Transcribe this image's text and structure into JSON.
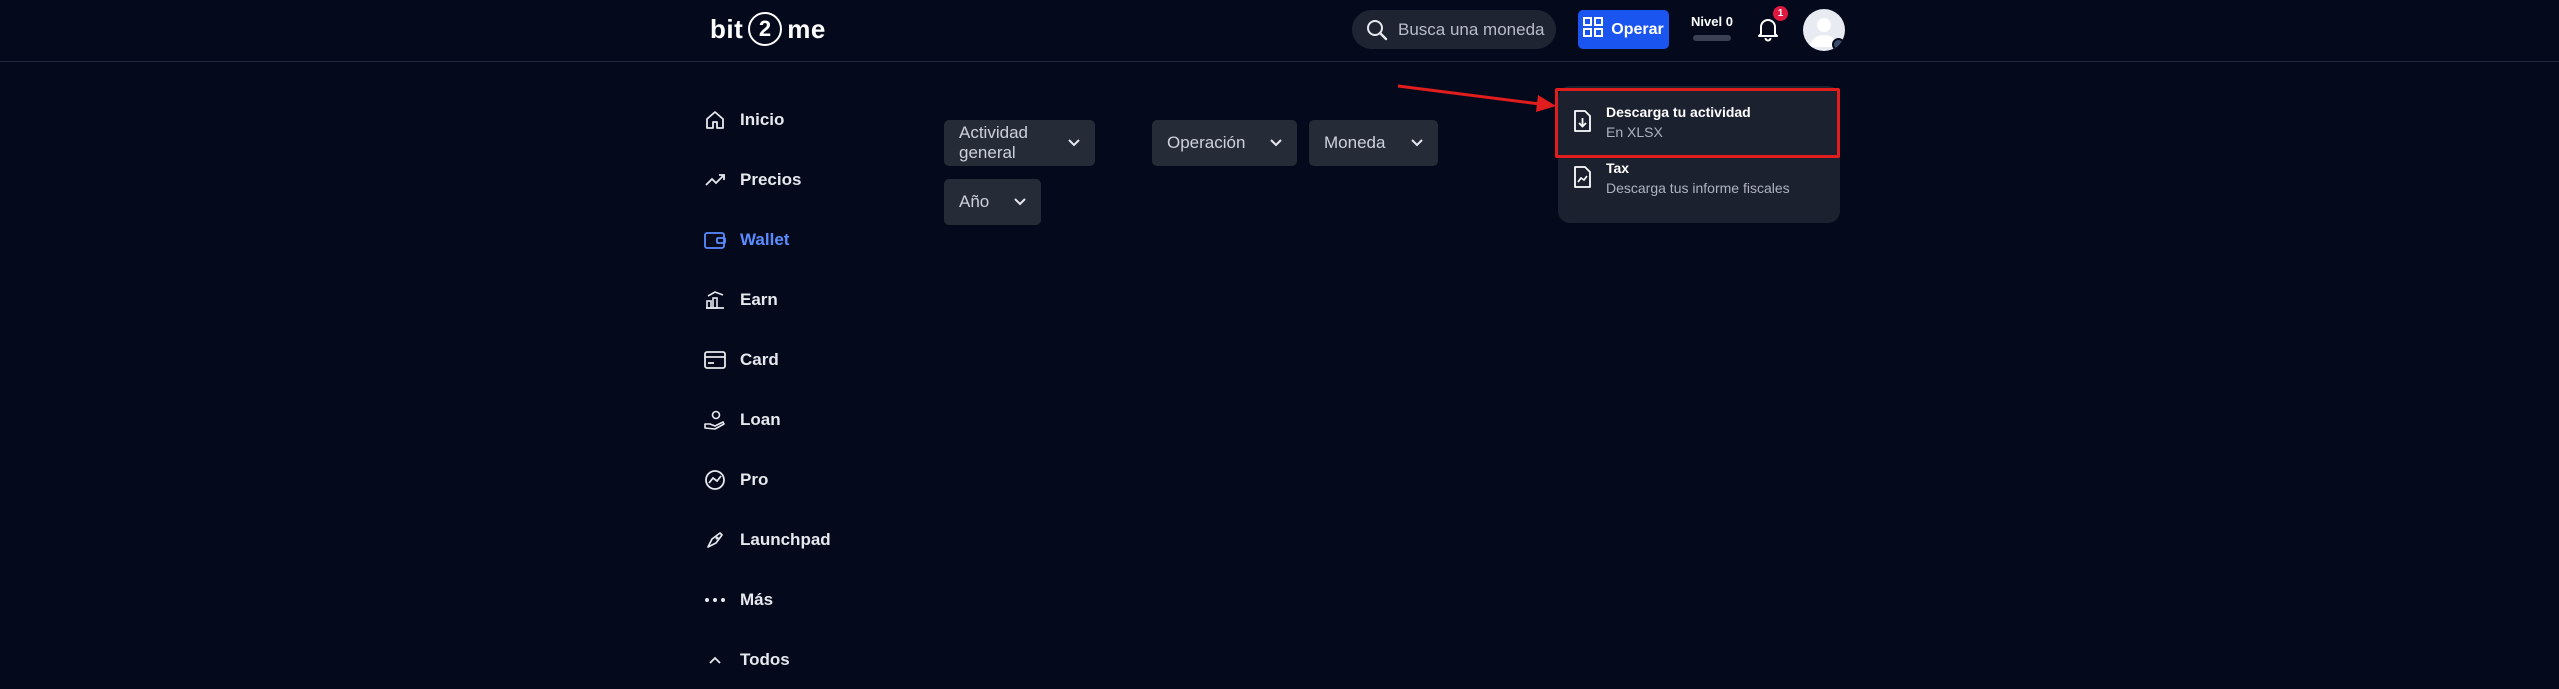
{
  "header": {
    "logo": {
      "left": "bit",
      "middle": "2",
      "right": "me"
    },
    "search": {
      "placeholder": "Busca una moneda",
      "icon": "search-icon"
    },
    "operar_label": "Operar",
    "nivel_label": "Nivel 0",
    "notifications_count": "1"
  },
  "sidebar": {
    "items": [
      {
        "label": "Inicio",
        "icon": "home-icon"
      },
      {
        "label": "Precios",
        "icon": "trend-up-icon"
      },
      {
        "label": "Wallet",
        "icon": "wallet-icon",
        "active": true
      },
      {
        "label": "Earn",
        "icon": "earn-icon"
      },
      {
        "label": "Card",
        "icon": "card-icon"
      },
      {
        "label": "Loan",
        "icon": "loan-icon"
      },
      {
        "label": "Pro",
        "icon": "pro-icon"
      },
      {
        "label": "Launchpad",
        "icon": "rocket-icon"
      },
      {
        "label": "Más",
        "icon": "more-dots-icon"
      },
      {
        "label": "Todos",
        "icon": "chevron-up-icon"
      }
    ]
  },
  "filters": {
    "actividad": "Actividad general",
    "operacion": "Operación",
    "moneda": "Moneda",
    "anio": "Año"
  },
  "menu": {
    "items": [
      {
        "title": "Descarga tu actividad",
        "subtitle": "En XLSX",
        "icon": "file-download-icon"
      },
      {
        "title": "Tax",
        "subtitle": "Descarga tus informe fiscales",
        "icon": "file-tax-icon"
      }
    ]
  },
  "colors": {
    "background": "#040a1c",
    "accent": "#1a55f0",
    "active_nav": "#5b8cff",
    "highlight": "#e11d1d",
    "badge": "#e0183f"
  }
}
